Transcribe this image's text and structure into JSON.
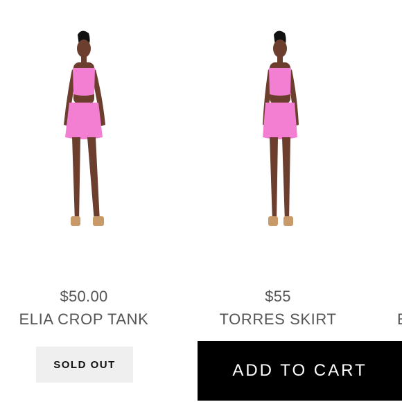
{
  "products": [
    {
      "image_alt": "Model in pink crop tank and skirt",
      "price": "$50.00",
      "name": "ELIA CROP TANK",
      "button_label": "SOLD OUT"
    },
    {
      "image_alt": "Model in pink crop tank and skirt",
      "price": "$55",
      "name": "TORRES SKIRT",
      "button_label": "ADD TO CART"
    }
  ],
  "next_product_peek": "E",
  "colors": {
    "garment_pink": "#f27fd1",
    "sold_out_bg": "#efefef",
    "add_to_cart_bg": "#000000"
  }
}
